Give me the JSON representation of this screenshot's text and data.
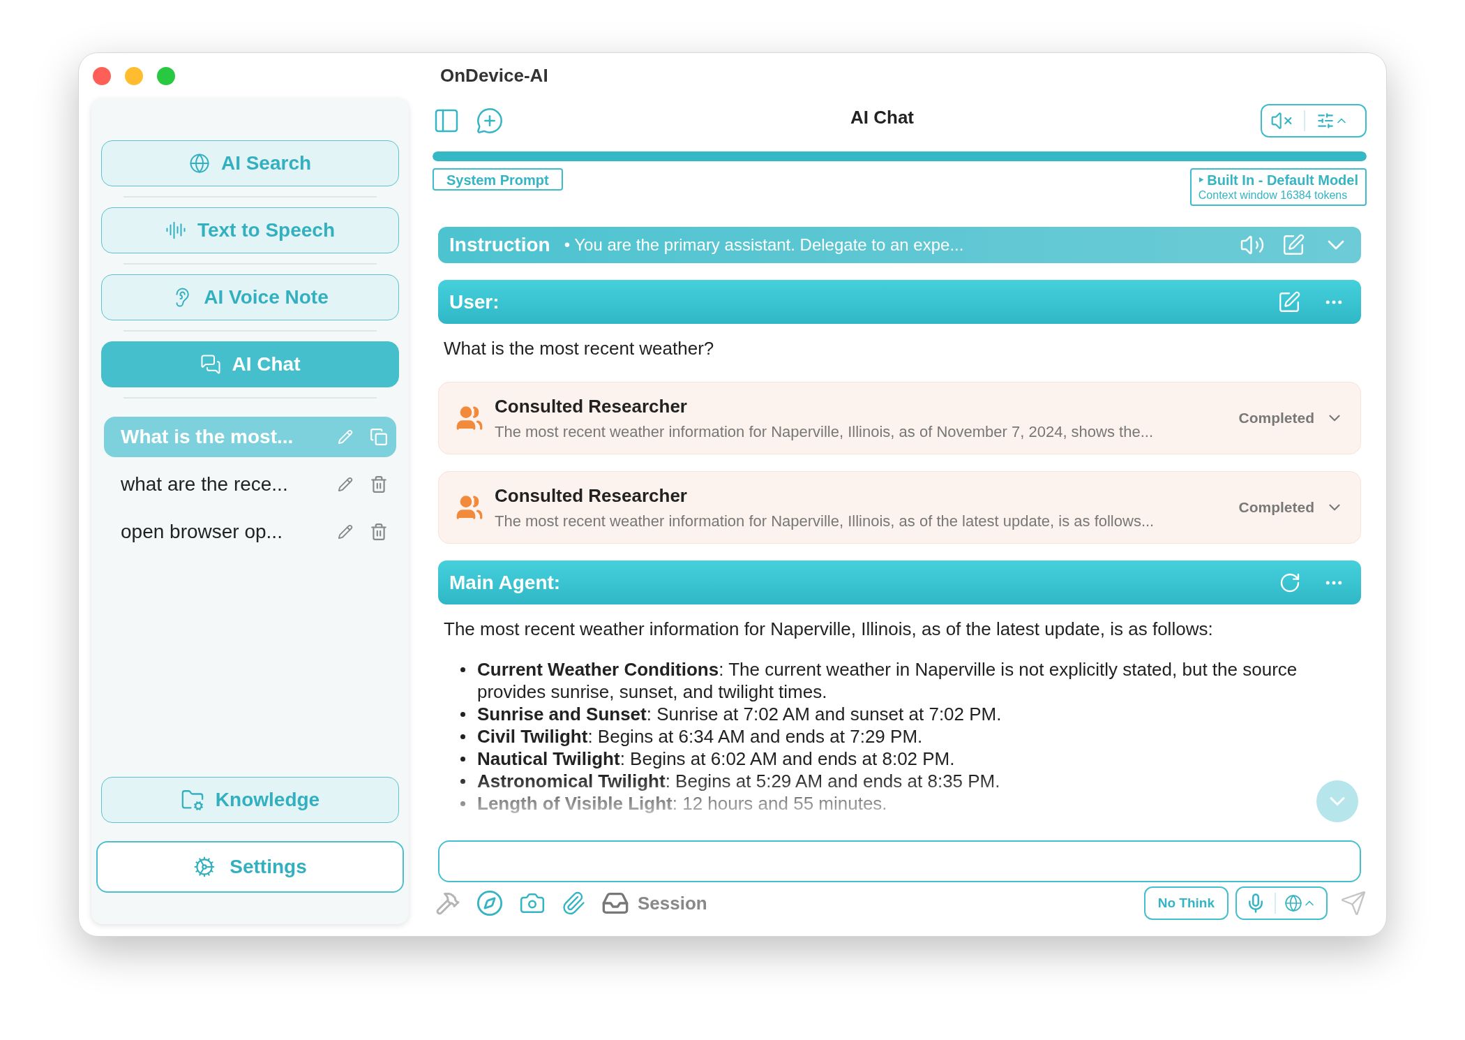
{
  "window": {
    "title": "OnDevice-AI"
  },
  "sidebar": {
    "nav": [
      {
        "label": "AI Search",
        "selected": false
      },
      {
        "label": "Text to Speech",
        "selected": false
      },
      {
        "label": "AI Voice Note",
        "selected": false
      },
      {
        "label": "AI Chat",
        "selected": true
      }
    ],
    "sessions": [
      {
        "title": "What is the most...",
        "selected": true
      },
      {
        "title": "what are the rece...",
        "selected": false
      },
      {
        "title": "open browser op...",
        "selected": false
      }
    ],
    "knowledge": "Knowledge",
    "settings": "Settings"
  },
  "header": {
    "title": "AI Chat",
    "progress": {
      "level": 1
    },
    "system_prompt": "System Prompt",
    "model": "‣ Built In - Default Model",
    "context": "Context window 16384 tokens"
  },
  "instruction": {
    "label": "Instruction",
    "text": "• You are the primary assistant. Delegate to an expe..."
  },
  "messages": [
    {
      "kind": "user",
      "role": "User:",
      "text": "What is the most recent weather?"
    },
    {
      "kind": "tool",
      "title": "Consulted Researcher",
      "summary": "The most recent weather information for Naperville, Illinois, as of November 7, 2024, shows the...",
      "status": "Completed"
    },
    {
      "kind": "tool",
      "title": "Consulted Researcher",
      "summary": "The most recent weather information for Naperville, Illinois, as of the latest update, is as follows...",
      "status": "Completed"
    },
    {
      "kind": "assistant",
      "role": "Main Agent:",
      "text": "The most recent weather information for Naperville, Illinois, as of the latest update, is as follows:",
      "bullets": [
        "**Current Weather Conditions**: The current weather in Naperville is not explicitly stated, but the source provides sunrise, sunset, and twilight times.",
        "**Sunrise and Sunset**: Sunrise at 7:02 AM and sunset at 7:02 PM.",
        "**Civil Twilight**: Begins at 6:34 AM and ends at 7:29 PM.",
        "**Nautical Twilight**: Begins at 6:02 AM and ends at 8:02 PM.",
        "**Astronomical Twilight**: Begins at 5:29 AM and ends at 8:35 PM.",
        "**Length of Visible Light**: 12 hours and 55 minutes."
      ]
    }
  ],
  "composer": {
    "session": "Session",
    "no_think": "No Think"
  }
}
